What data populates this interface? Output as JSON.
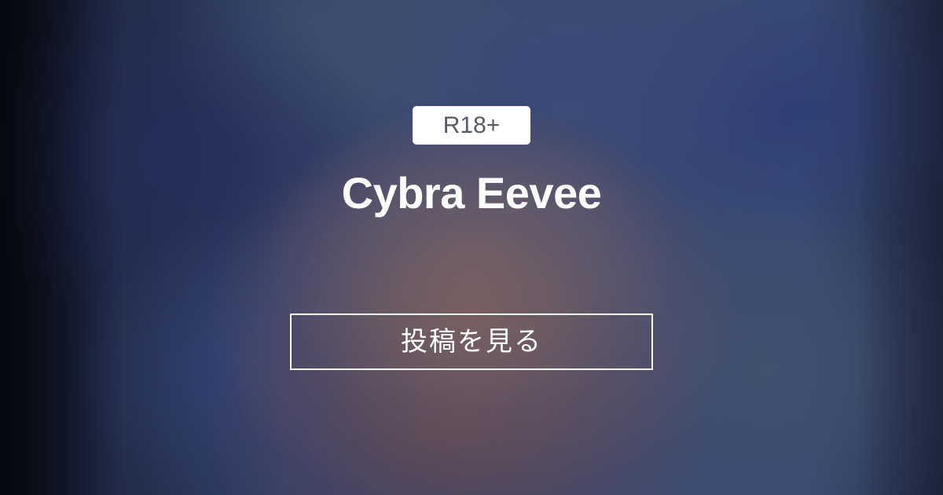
{
  "badge": {
    "label": "R18+"
  },
  "title": "Cybra Eevee",
  "cta": {
    "label": "投稿を見る"
  },
  "colors": {
    "badge_background": "#ffffff",
    "badge_text": "#555a66",
    "text": "#ffffff",
    "background_blur_base": "#3a4466"
  }
}
